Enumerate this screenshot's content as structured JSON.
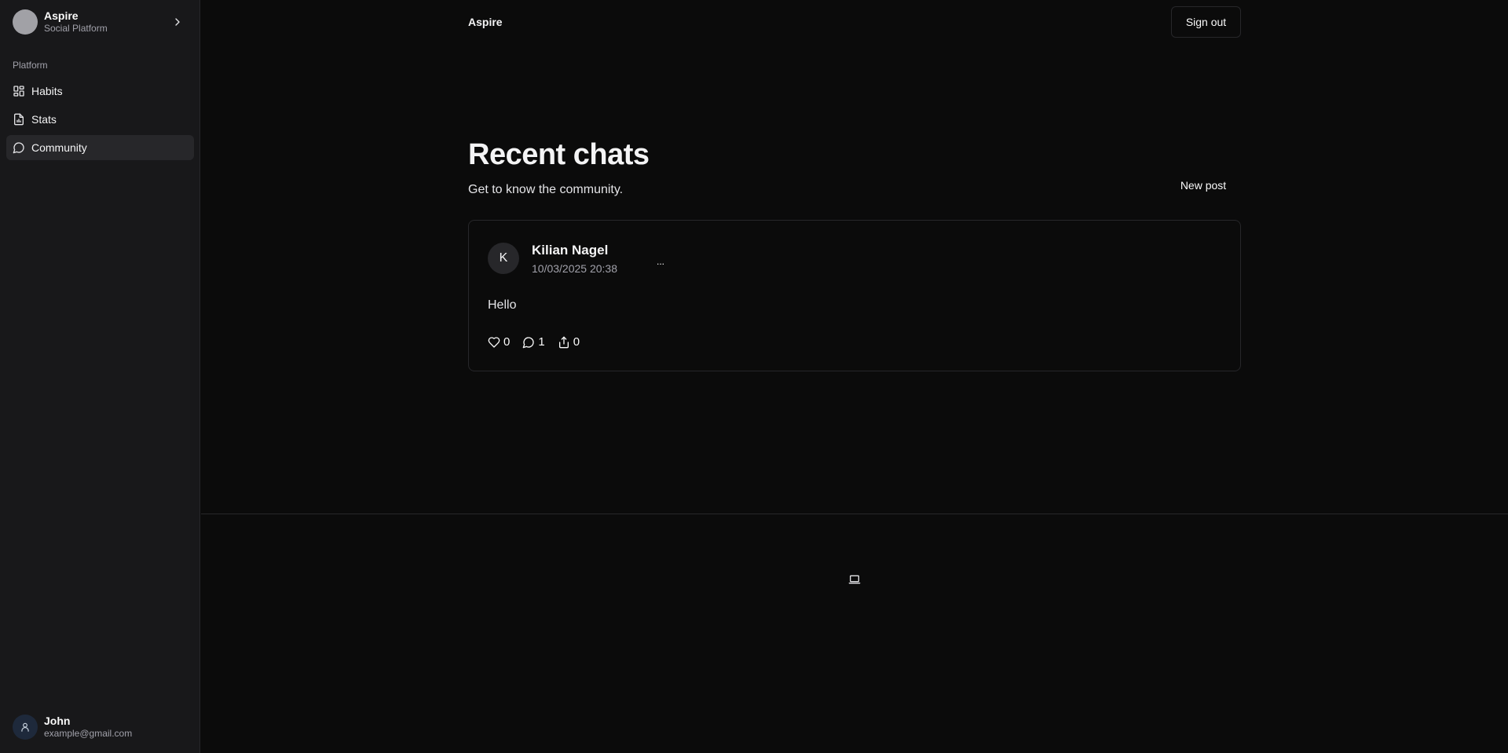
{
  "sidebar": {
    "brand": {
      "name": "Aspire",
      "subtitle": "Social Platform"
    },
    "group_label": "Platform",
    "items": [
      {
        "label": "Habits",
        "icon": "layout-grid-icon"
      },
      {
        "label": "Stats",
        "icon": "file-chart-icon"
      },
      {
        "label": "Community",
        "icon": "message-circle-icon",
        "active": true
      }
    ],
    "user": {
      "name": "John",
      "email": "example@gmail.com"
    }
  },
  "header": {
    "title": "Aspire",
    "signout_label": "Sign out"
  },
  "main": {
    "title": "Recent chats",
    "subtitle": "Get to know the community.",
    "new_post_label": "New post",
    "posts": [
      {
        "avatar_initial": "K",
        "author": "Kilian Nagel",
        "timestamp": "10/03/2025 20:38",
        "more_label": "...",
        "body": "Hello",
        "likes": "0",
        "comments": "1",
        "shares": "0"
      }
    ]
  },
  "footer": {
    "icon": "laptop-icon"
  },
  "colors": {
    "background": "#0b0b0b",
    "sidebar": "#18181a",
    "active_item": "#27272a",
    "border": "#27272a",
    "muted_text": "#a1a1aa"
  }
}
